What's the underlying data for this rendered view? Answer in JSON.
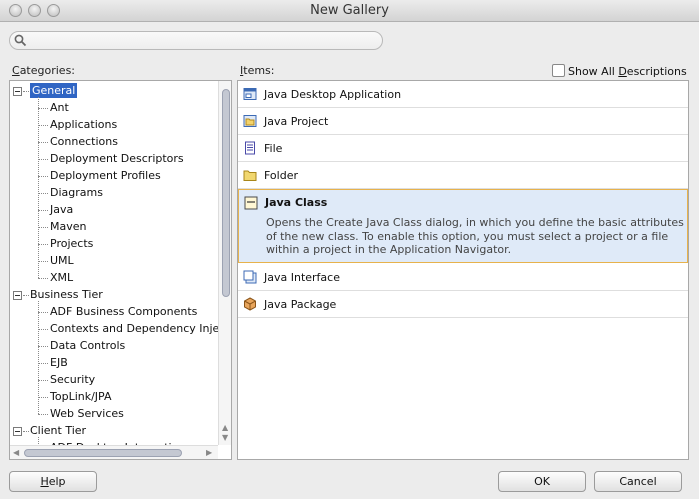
{
  "window": {
    "title": "New Gallery"
  },
  "search": {
    "placeholder": ""
  },
  "categories": {
    "label": "Categories:",
    "label_mnemonic": "C",
    "label_rest": "ategories:",
    "nodes": [
      {
        "label": "General",
        "level": 0,
        "expander": true,
        "selected": true
      },
      {
        "label": "Ant",
        "level": 1
      },
      {
        "label": "Applications",
        "level": 1
      },
      {
        "label": "Connections",
        "level": 1
      },
      {
        "label": "Deployment Descriptors",
        "level": 1
      },
      {
        "label": "Deployment Profiles",
        "level": 1
      },
      {
        "label": "Diagrams",
        "level": 1
      },
      {
        "label": "Java",
        "level": 1
      },
      {
        "label": "Maven",
        "level": 1
      },
      {
        "label": "Projects",
        "level": 1
      },
      {
        "label": "UML",
        "level": 1
      },
      {
        "label": "XML",
        "level": 1
      },
      {
        "label": "Business Tier",
        "level": 0,
        "expander": true
      },
      {
        "label": "ADF Business Components",
        "level": 1
      },
      {
        "label": "Contexts and Dependency Injec",
        "level": 1
      },
      {
        "label": "Data Controls",
        "level": 1
      },
      {
        "label": "EJB",
        "level": 1
      },
      {
        "label": "Security",
        "level": 1
      },
      {
        "label": "TopLink/JPA",
        "level": 1
      },
      {
        "label": "Web Services",
        "level": 1
      },
      {
        "label": "Client Tier",
        "level": 0,
        "expander": true
      },
      {
        "label": "ADF Desktop Integration",
        "level": 1
      }
    ]
  },
  "items": {
    "label": "Items:",
    "label_mnemonic": "I",
    "label_rest": "tems:",
    "show_all": {
      "prefix": "Show All ",
      "mnemonic": "D",
      "rest": "escriptions",
      "checked": false
    },
    "list": [
      {
        "label": "Java Desktop Application",
        "icon": "desktop-app-icon"
      },
      {
        "label": "Java Project",
        "icon": "project-icon"
      },
      {
        "label": "File",
        "icon": "file-icon"
      },
      {
        "label": "Folder",
        "icon": "folder-icon"
      },
      {
        "label": "Java Class",
        "icon": "java-class-icon",
        "selected": true,
        "description": "Opens the Create Java Class dialog, in which you define the basic attributes of the new class. To enable this option, you must select a project or a file within a project in the Application Navigator."
      },
      {
        "label": "Java Interface",
        "icon": "java-interface-icon"
      },
      {
        "label": "Java Package",
        "icon": "java-package-icon"
      }
    ]
  },
  "buttons": {
    "help": {
      "mnemonic": "H",
      "rest": "elp"
    },
    "ok": "OK",
    "cancel": "Cancel"
  }
}
